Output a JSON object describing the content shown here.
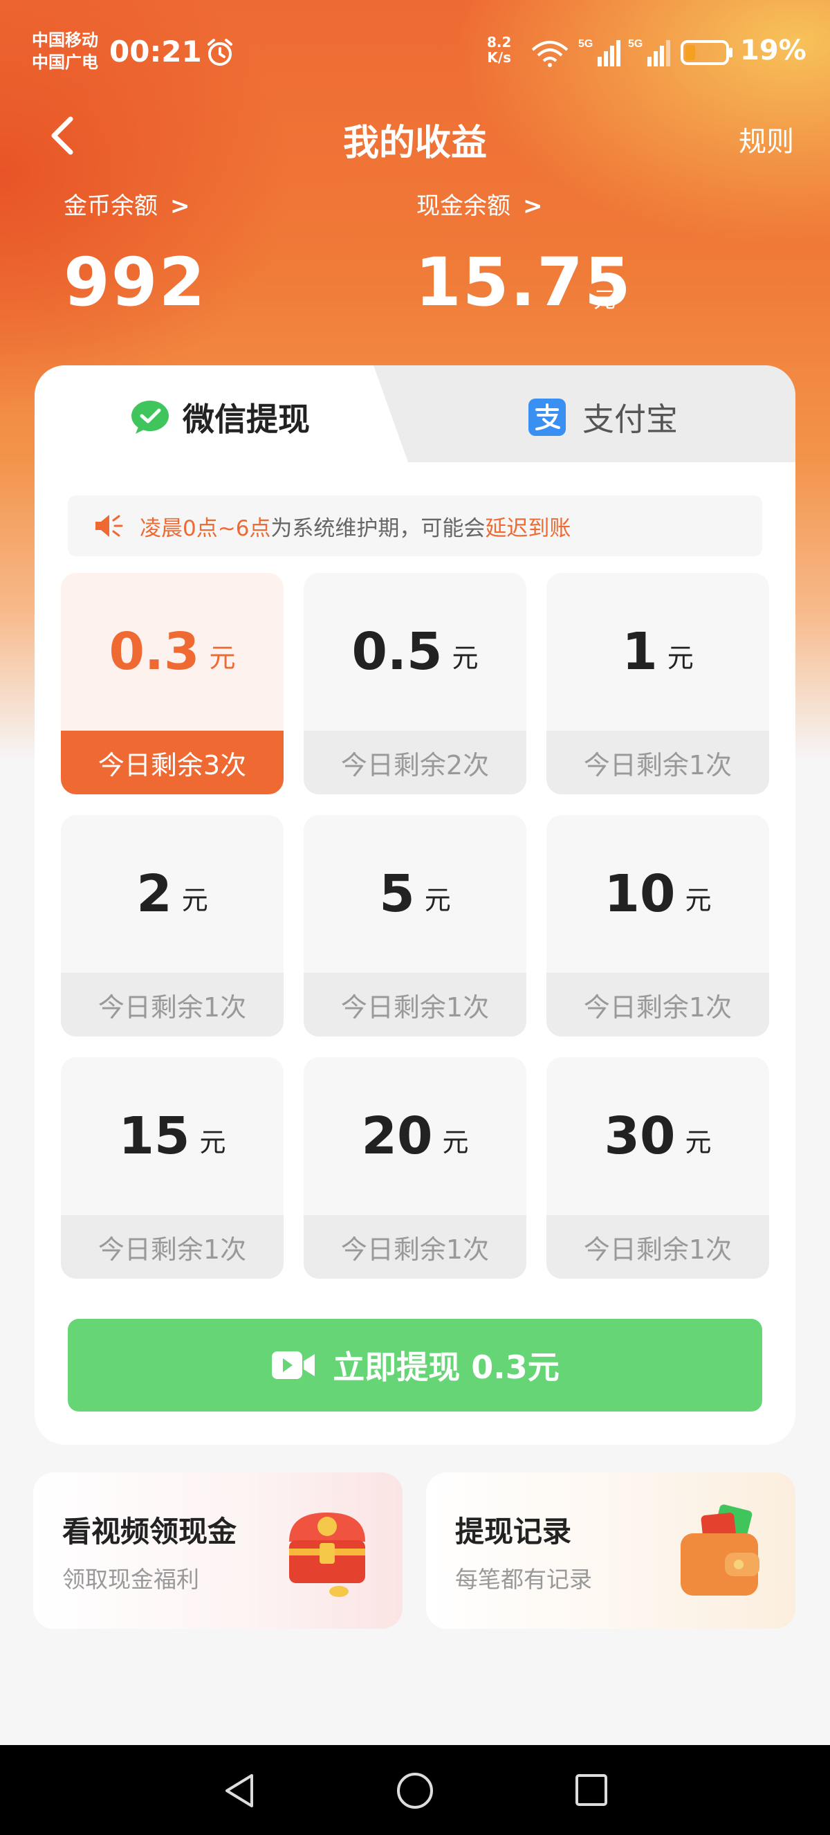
{
  "status_bar": {
    "carrier1": "中国移动",
    "carrier2": "中国广电",
    "time": "00:21",
    "net_speed_value": "8.2",
    "net_speed_unit": "K/s",
    "sig_label_1": "5G",
    "sig_label_2": "5G",
    "battery": "19%"
  },
  "header": {
    "title": "我的收益",
    "rules_label": "规则"
  },
  "balances": {
    "coin_label": "金币余额",
    "coin_value": "992",
    "cash_label": "现金余额",
    "cash_value": "15.75",
    "cash_unit": "元",
    "chevron": ">"
  },
  "tabs": {
    "wechat": "微信提现",
    "alipay": "支付宝",
    "active": "wechat"
  },
  "notice": {
    "part1": "凌晨0点~6点",
    "part2": "为系统维护期，可能会",
    "part3": "延迟到账"
  },
  "options": [
    {
      "amount": "0.3",
      "unit": "元",
      "remaining": "今日剩余3次",
      "selected": true
    },
    {
      "amount": "0.5",
      "unit": "元",
      "remaining": "今日剩余2次",
      "selected": false
    },
    {
      "amount": "1",
      "unit": "元",
      "remaining": "今日剩余1次",
      "selected": false
    },
    {
      "amount": "2",
      "unit": "元",
      "remaining": "今日剩余1次",
      "selected": false
    },
    {
      "amount": "5",
      "unit": "元",
      "remaining": "今日剩余1次",
      "selected": false
    },
    {
      "amount": "10",
      "unit": "元",
      "remaining": "今日剩余1次",
      "selected": false
    },
    {
      "amount": "15",
      "unit": "元",
      "remaining": "今日剩余1次",
      "selected": false
    },
    {
      "amount": "20",
      "unit": "元",
      "remaining": "今日剩余1次",
      "selected": false
    },
    {
      "amount": "30",
      "unit": "元",
      "remaining": "今日剩余1次",
      "selected": false
    }
  ],
  "withdraw_button": "立即提现 0.3元",
  "cards": {
    "video": {
      "title": "看视频领现金",
      "subtitle": "领取现金福利"
    },
    "records": {
      "title": "提现记录",
      "subtitle": "每笔都有记录"
    }
  },
  "colors": {
    "accent": "#ef6a33",
    "button_green": "#66d575",
    "wechat_green": "#3fc55c",
    "alipay_blue": "#3a8ff2"
  }
}
